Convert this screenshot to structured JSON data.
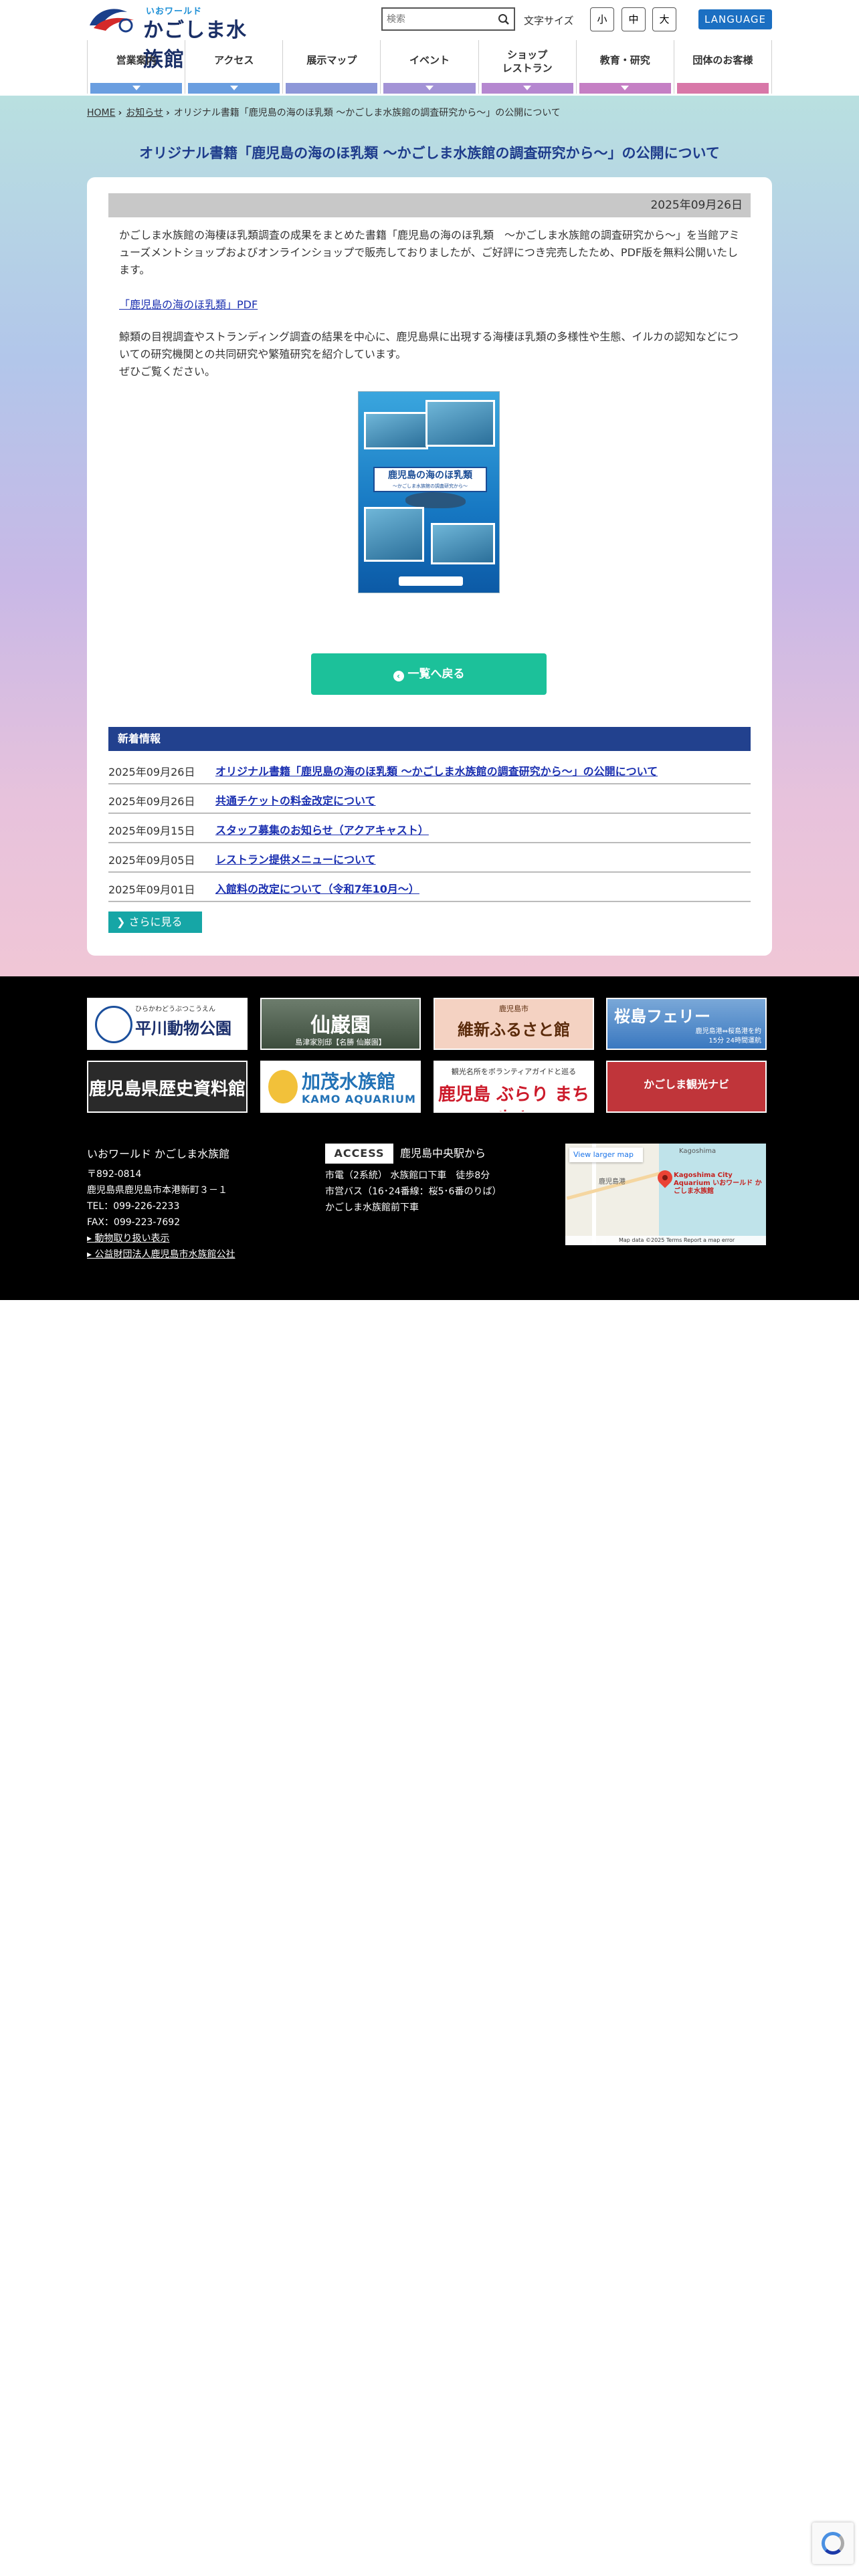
{
  "header": {
    "logo_sub": "いおワールド",
    "logo_main": "かごしま水族館",
    "search_placeholder": "検索",
    "fontsize_label": "文字サイズ",
    "fontsize_small": "小",
    "fontsize_mid": "中",
    "fontsize_large": "大",
    "language_label": "LANGUAGE"
  },
  "gnav": [
    {
      "label": "営業案内",
      "color": "#6a9ee0",
      "arrow": true
    },
    {
      "label": "アクセス",
      "color": "#6a9ee0",
      "arrow": true
    },
    {
      "label": "展示マップ",
      "color": "#8d97d8",
      "arrow": false
    },
    {
      "label": "イベント",
      "color": "#a393d6",
      "arrow": true
    },
    {
      "label_line1": "ショップ",
      "label_line2": "レストラン",
      "color": "#b587d0",
      "arrow": true
    },
    {
      "label": "教育・研究",
      "color": "#c57fc4",
      "arrow": true
    },
    {
      "label": "団体のお客様",
      "color": "#d877a8",
      "arrow": false
    }
  ],
  "breadcrumb": {
    "home": "HOME",
    "news": "お知らせ",
    "current": "オリジナル書籍「鹿児島の海のほ乳類 〜かごしま水族館の調査研究から〜」の公開について"
  },
  "article": {
    "title": "オリジナル書籍「鹿児島の海のほ乳類 〜かごしま水族館の調査研究から〜」の公開について",
    "date": "2025年09月26日",
    "paragraph1": "かごしま水族館の海棲ほ乳類調査の成果をまとめた書籍「鹿児島の海のほ乳類　〜かごしま水族館の調査研究から〜」を当館アミューズメントショップおよびオンラインショップで販売しておりましたが、ご好評につき完売したため、PDF版を無料公開いたします。",
    "pdf_link": "「鹿児島の海のほ乳類」PDF",
    "paragraph2_line1": "鯨類の目視調査やストランディング調査の結果を中心に、鹿児島県に出現する海棲ほ乳類の多様性や生態、イルカの認知などについての研究機関との共同研究や繁殖研究を紹介しています。",
    "paragraph2_line2": "ぜひご覧ください。",
    "book_title": "鹿児島の海のほ乳類",
    "book_subtitle": "〜かごしま水族館の調査研究から〜",
    "back_label": "一覧へ戻る"
  },
  "news": {
    "heading": "新着情報",
    "items": [
      {
        "date": "2025年09月26日",
        "title": "オリジナル書籍「鹿児島の海のほ乳類 〜かごしま水族館の調査研究から〜」の公開について"
      },
      {
        "date": "2025年09月26日",
        "title": "共通チケットの料金改定について"
      },
      {
        "date": "2025年09月15日",
        "title": "スタッフ募集のお知らせ（アクアキャスト）"
      },
      {
        "date": "2025年09月05日",
        "title": "レストラン提供メニューについて"
      },
      {
        "date": "2025年09月01日",
        "title": "入館料の改定について（令和7年10月〜）"
      }
    ],
    "more_label": "さらに見る"
  },
  "banners": {
    "b1_sub": "ひらかわどうぶつこうえん",
    "b1_title": "平川動物公園",
    "b2_title": "仙巌園",
    "b2_sub": "島津家別邸【名勝 仙巌園】",
    "b3_sub": "鹿児島市",
    "b3_title": "維新ふるさと館",
    "b4_title": "桜島フェリー",
    "b4_sub": "鹿児島港⇔桜島港を約15分 24時間運航",
    "b5_title": "鹿児島県歴史資料館",
    "b6_title": "加茂水族館",
    "b6_sub": "KAMO AQUARIUM",
    "b7_sub": "観光名所をボランティアガイドと巡る",
    "b7_title": "鹿児島 ぶらり まち歩き",
    "b8_title": "かごしま観光ナビ"
  },
  "footer": {
    "name": "いおワールド かごしま水族館",
    "postal": "〒892-0814",
    "address": "鹿児島県鹿児島市本港新町３－１",
    "tel": "TEL：099-226-2233",
    "fax": "FAX：099-223-7692",
    "link1": "動物取り扱い表示",
    "link2": "公益財団法人鹿児島市水族館公社",
    "access_label": "ACCESS",
    "access_from": "鹿児島中央駅から",
    "access_line1": "市電（2系統） 水族館口下車　徒歩8分",
    "access_line2": "市営バス（16･24番線：桜5･6番のりば）",
    "access_line3": "かごしま水族館前下車",
    "map_view_label": "View larger map",
    "map_place_label": "Kagoshima City Aquarium いおワールド かごしま水族館",
    "map_label_a": "鹿児島港",
    "map_label_b": "Kagoshima",
    "map_attribution": "Map data ©2025   Terms   Report a map error"
  }
}
